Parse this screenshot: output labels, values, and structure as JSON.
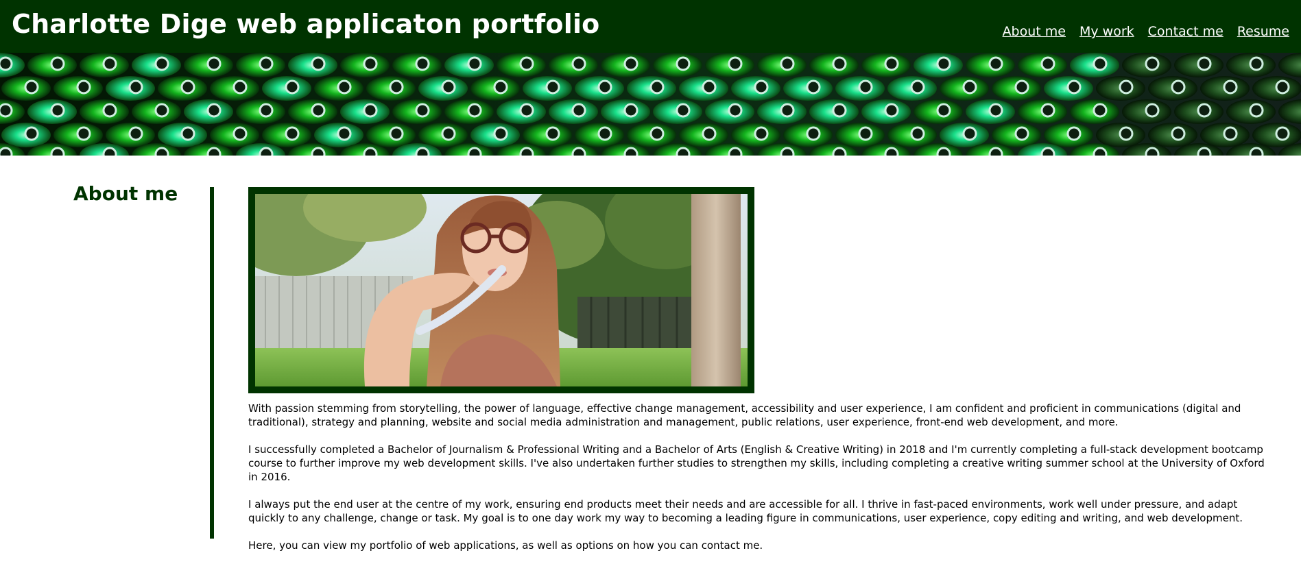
{
  "header": {
    "title": "Charlotte Dige web applicaton portfolio",
    "nav": [
      {
        "label": "About me"
      },
      {
        "label": "My work"
      },
      {
        "label": "Contact me"
      },
      {
        "label": "Resume"
      }
    ]
  },
  "hero": {
    "description": "banner photo of rows of glowing green glass bottles"
  },
  "about": {
    "heading": "About me",
    "photo": "portrait photo of a woman with glasses holding a pen",
    "paragraphs": [
      "With passion stemming from storytelling, the power of language, effective change management, accessibility and user experience, I am confident and proficient in communications (digital and traditional), strategy and planning, website and social media administration and management, public relations, user experience, front-end web development, and more.",
      "I successfully completed a Bachelor of Journalism & Professional Writing and a Bachelor of Arts (English & Creative Writing) in 2018 and I'm currently completing a full-stack development bootcamp course to further improve my web development skills. I've also undertaken further studies to strengthen my skills, including completing a creative writing summer school at the University of Oxford in 2016.",
      "I always put the end user at the centre of my work, ensuring end products meet their needs and are accessible for all. I thrive in fast-paced environments, work well under pressure, and adapt quickly to any challenge, change or task. My goal is to one day work my way to becoming a leading figure in communications, user experience, copy editing and writing, and web development.",
      "Here, you can view my portfolio of web applications, as well as options on how you can contact me."
    ]
  },
  "colors": {
    "brand": "#003300",
    "text": "#000000",
    "background": "#ffffff"
  }
}
